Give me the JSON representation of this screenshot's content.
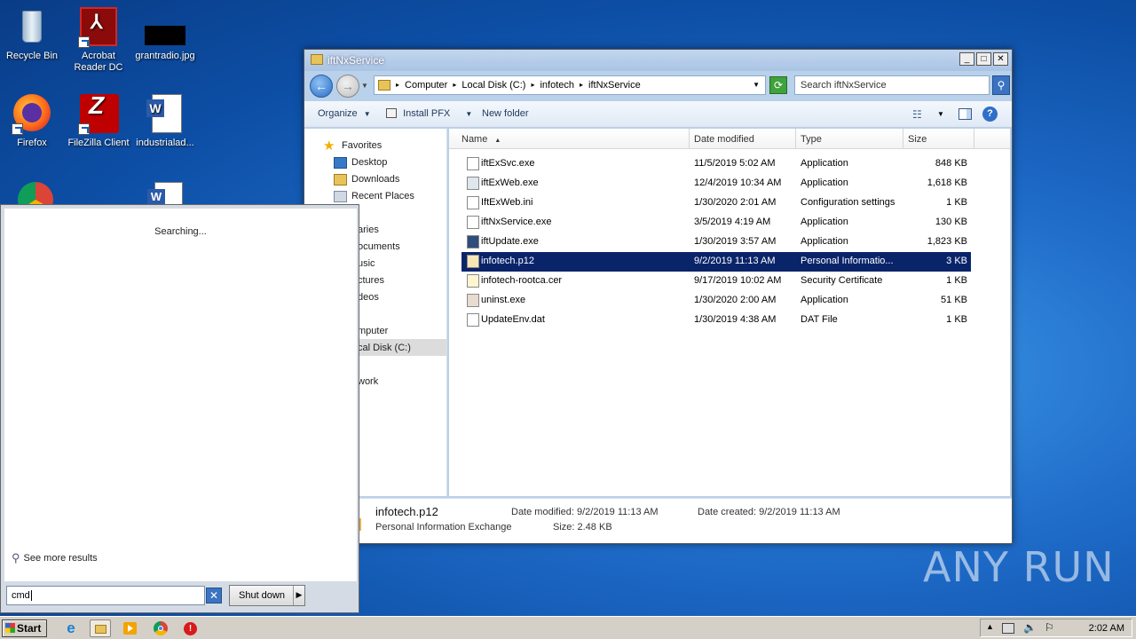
{
  "desktop": {
    "icons": [
      {
        "label": "Recycle Bin"
      },
      {
        "label": "Acrobat\nReader DC"
      },
      {
        "label": "grantradio.jpg"
      },
      {
        "label": "Firefox"
      },
      {
        "label": "FileZilla Client"
      },
      {
        "label": "industrialad..."
      }
    ]
  },
  "explorer": {
    "title": "iftNxService",
    "breadcrumbs": [
      "Computer",
      "Local Disk (C:)",
      "infotech",
      "iftNxService"
    ],
    "search_placeholder": "Search iftNxService",
    "toolbar": {
      "organize": "Organize",
      "install_pfx": "Install PFX",
      "new_folder": "New folder"
    },
    "nav": {
      "favorites": "Favorites",
      "desktop": "Desktop",
      "downloads": "Downloads",
      "recent": "Recent Places",
      "libraries": "aries",
      "documents": "ocuments",
      "music": "usic",
      "pictures": "ctures",
      "videos": "deos",
      "computer": "mputer",
      "local_disk": "cal Disk (C:)",
      "network": "work"
    },
    "columns": {
      "name": "Name",
      "date": "Date modified",
      "type": "Type",
      "size": "Size"
    },
    "files": [
      {
        "name": "iftExSvc.exe",
        "date": "11/5/2019 5:02 AM",
        "type": "Application",
        "size": "848 KB"
      },
      {
        "name": "iftExWeb.exe",
        "date": "12/4/2019 10:34 AM",
        "type": "Application",
        "size": "1,618 KB"
      },
      {
        "name": "IftExWeb.ini",
        "date": "1/30/2020 2:01 AM",
        "type": "Configuration settings",
        "size": "1 KB"
      },
      {
        "name": "iftNxService.exe",
        "date": "3/5/2019 4:19 AM",
        "type": "Application",
        "size": "130 KB"
      },
      {
        "name": "iftUpdate.exe",
        "date": "1/30/2019 3:57 AM",
        "type": "Application",
        "size": "1,823 KB"
      },
      {
        "name": "infotech.p12",
        "date": "9/2/2019 11:13 AM",
        "type": "Personal Informatio...",
        "size": "3 KB"
      },
      {
        "name": "infotech-rootca.cer",
        "date": "9/17/2019 10:02 AM",
        "type": "Security Certificate",
        "size": "1 KB"
      },
      {
        "name": "uninst.exe",
        "date": "1/30/2020 2:00 AM",
        "type": "Application",
        "size": "51 KB"
      },
      {
        "name": "UpdateEnv.dat",
        "date": "1/30/2019 4:38 AM",
        "type": "DAT File",
        "size": "1 KB"
      }
    ],
    "details": {
      "filename": "infotech.p12",
      "filetype": "Personal Information Exchange",
      "modified": "Date modified: 9/2/2019 11:13 AM",
      "size": "Size: 2.48 KB",
      "created": "Date created: 9/2/2019 11:13 AM"
    }
  },
  "startmenu": {
    "searching": "Searching...",
    "see_more": "See more results",
    "search_value": "cmd",
    "shutdown": "Shut down"
  },
  "taskbar": {
    "start": "Start",
    "clock": "2:02 AM"
  },
  "watermark": "ANY RUN"
}
